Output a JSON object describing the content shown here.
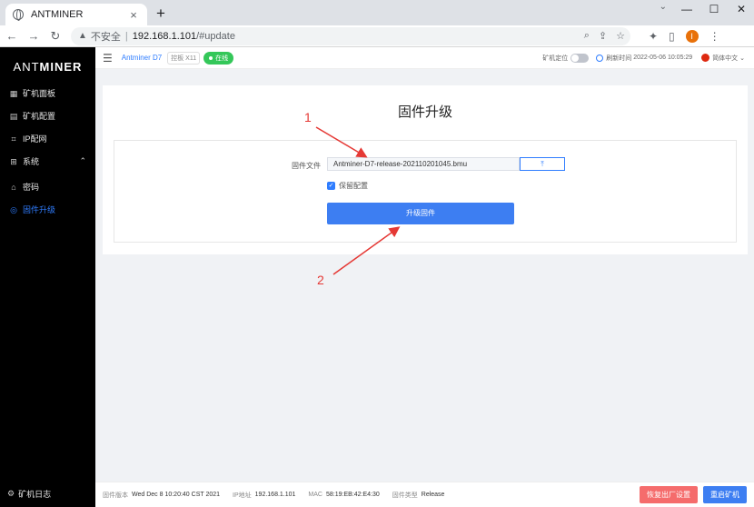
{
  "browser": {
    "tab_title": "ANTMINER",
    "tab_close": "×",
    "new_tab": "+",
    "nav": {
      "back": "←",
      "forward": "→",
      "reload": "↻"
    },
    "omnibox": {
      "insecure_label": "不安全",
      "separator": "|",
      "host": "192.168.1.101",
      "path": "/#update"
    },
    "omni_icons": [
      "search-icon",
      "share-icon",
      "star-icon"
    ],
    "tool_icons": [
      "extensions-icon",
      "sidepanel-icon"
    ],
    "profile_initial": "I",
    "menu_glyph": "⋮",
    "window_controls": {
      "minimize": "—",
      "maximize": "☐",
      "close": "✕"
    },
    "tab_list_glyph": "⌄"
  },
  "sidebar": {
    "logo_ant": "ANT",
    "logo_miner": "MINER",
    "items": [
      {
        "label": "矿机面板",
        "icon": "dashboard-icon"
      },
      {
        "label": "矿机配置",
        "icon": "config-icon"
      },
      {
        "label": "IP配网",
        "icon": "network-icon"
      },
      {
        "label": "系统",
        "icon": "system-icon",
        "expanded": true
      },
      {
        "label": "密码",
        "icon": "lock-icon"
      },
      {
        "label": "固件升级",
        "icon": "firmware-icon",
        "active": true
      }
    ],
    "bottom_label": "矿机日志"
  },
  "topbar": {
    "model": "Antminer D7",
    "control_board": "控板 X11",
    "status": "在线",
    "locate_label": "矿机定位",
    "refresh_label": "刷新时间",
    "refresh_time": "2022-05-06 10:05:29",
    "language": "简体中文"
  },
  "main": {
    "title": "固件升级",
    "field_label": "固件文件",
    "file_value": "Antminer-D7-release-202110201045.bmu",
    "upload_glyph": "⤒",
    "keep_settings_label": "保留配置",
    "keep_settings_checked": true,
    "submit_label": "升级固件"
  },
  "annotations": {
    "one": "1",
    "two": "2",
    "color": "#e53935"
  },
  "footer": {
    "fw_version_label": "固件版本",
    "fw_version": "Wed Dec 8 10:20:40 CST 2021",
    "ip_label": "IP地址",
    "ip": "192.168.1.101",
    "mac_label": "MAC",
    "mac": "58:19:EB:42:E4:30",
    "fw_type_label": "固件类型",
    "fw_type": "Release",
    "reset_label": "恢复出厂设置",
    "reboot_label": "重启矿机"
  },
  "colors": {
    "accent": "#3d7ef2",
    "danger": "#f56c6c",
    "online": "#34c759"
  }
}
